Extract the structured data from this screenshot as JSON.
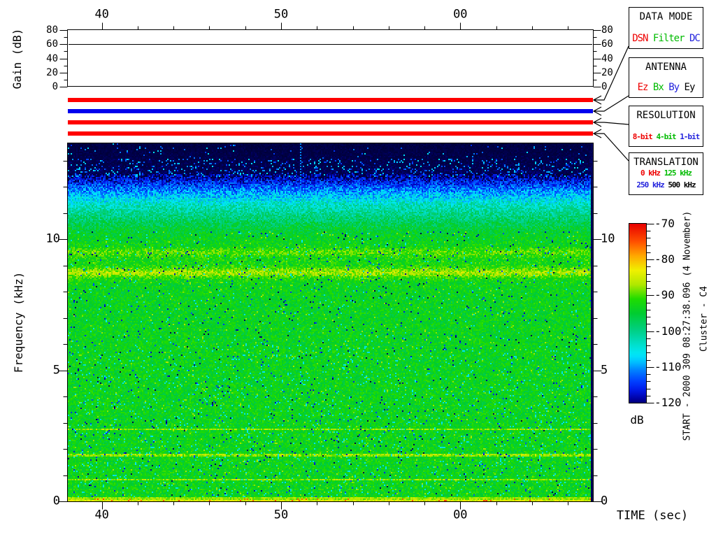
{
  "gain_plot": {
    "ylabel": "Gain (dB)"
  },
  "spectrogram_plot": {
    "ylabel": "Frequency (kHz)",
    "xlabel": "TIME (sec)"
  },
  "colorbar": {
    "unit": "dB"
  },
  "side_annotations": {
    "start": "START - 2000 309 08:27:38.096 (4 November)",
    "spacecraft": "Cluster - C4"
  },
  "status_bars": [
    {
      "panel": "DATA MODE",
      "selected": "DSN",
      "color": "#ff0000"
    },
    {
      "panel": "ANTENNA",
      "selected": "By",
      "color": "#0000ee"
    },
    {
      "panel": "RESOLUTION",
      "selected": "8-bit",
      "color": "#ff0000"
    },
    {
      "panel": "TRANSLATION",
      "selected": "0 kHz",
      "color": "#ff0000"
    }
  ],
  "panels": [
    {
      "title": "DATA MODE",
      "rows": [
        [
          {
            "label": "DSN",
            "color": "#ee0000"
          },
          {
            "label": "Filter",
            "color": "#00bb00"
          },
          {
            "label": "DC",
            "color": "#2222dd"
          }
        ]
      ]
    },
    {
      "title": "ANTENNA",
      "rows": [
        [
          {
            "label": "Ez",
            "color": "#ee0000"
          },
          {
            "label": "Bx",
            "color": "#00bb00"
          },
          {
            "label": "By",
            "color": "#2222dd"
          },
          {
            "label": "Ey",
            "color": "#000000"
          }
        ]
      ]
    },
    {
      "title": "RESOLUTION",
      "rows": [
        [
          {
            "label": "8-bit",
            "color": "#ee0000"
          },
          {
            "label": "4-bit",
            "color": "#00bb00"
          },
          {
            "label": "1-bit",
            "color": "#2222dd"
          }
        ]
      ]
    },
    {
      "title": "TRANSLATION",
      "rows": [
        [
          {
            "label": "0 kHz",
            "color": "#ee0000"
          },
          {
            "label": "125 kHz",
            "color": "#00bb00"
          }
        ],
        [
          {
            "label": "250 kHz",
            "color": "#2222dd"
          },
          {
            "label": "500 kHz",
            "color": "#000000"
          }
        ]
      ]
    }
  ],
  "chart_data": [
    {
      "type": "line",
      "title": "Gain (dB)",
      "ylabel": "Gain (dB)",
      "x_range_sec": [
        38.1,
        67.4
      ],
      "x_major_ticks": [
        {
          "sec": 40,
          "label": "40"
        },
        {
          "sec": 50,
          "label": "50"
        },
        {
          "sec": 60,
          "label": "00"
        }
      ],
      "x_minor_step_sec": 2,
      "ylim": [
        0,
        80
      ],
      "y_ticks": [
        0,
        20,
        40,
        60,
        80
      ],
      "y_minor_step": 10,
      "constant_value_db": 60
    },
    {
      "type": "heatmap",
      "xlabel": "TIME (sec)",
      "ylabel": "Frequency (kHz)",
      "x_range_sec": [
        38.1,
        67.4
      ],
      "x_major_ticks": [
        {
          "sec": 40,
          "label": "40"
        },
        {
          "sec": 50,
          "label": "50"
        },
        {
          "sec": 60,
          "label": "00"
        }
      ],
      "x_minor_step_sec": 2,
      "y_range_khz": [
        0,
        13.66
      ],
      "y_major_ticks": [
        {
          "khz": 0,
          "label": "0"
        },
        {
          "khz": 5,
          "label": "5"
        },
        {
          "khz": 10,
          "label": "10"
        }
      ],
      "y_minor_step_khz": 1,
      "color_scale": {
        "unit": "dB",
        "min": -120,
        "max": -70,
        "major_ticks": [
          -70,
          -80,
          -90,
          -100,
          -110,
          -120
        ],
        "minor_step": 2
      },
      "features": {
        "background_noise_db": -93.5,
        "upper_cutoff_khz": 12.3,
        "above_cutoff_floor_db": -121,
        "emission_bands": [
          {
            "center_khz": 8.72,
            "peak_boost_db": 5.8,
            "width_khz": 0.13
          },
          {
            "center_khz": 9.5,
            "peak_boost_db": 3.2,
            "width_khz": 0.12
          },
          {
            "center_khz": 9.05,
            "peak_boost_db": 1.1,
            "width_khz": 0.5
          }
        ],
        "narrowband_lines_khz": [
          2.75,
          1.76,
          0.83
        ],
        "bottom_edge_enhanced_db": -84.5,
        "vertical_dashed_marker_sec": 51.1
      }
    }
  ]
}
